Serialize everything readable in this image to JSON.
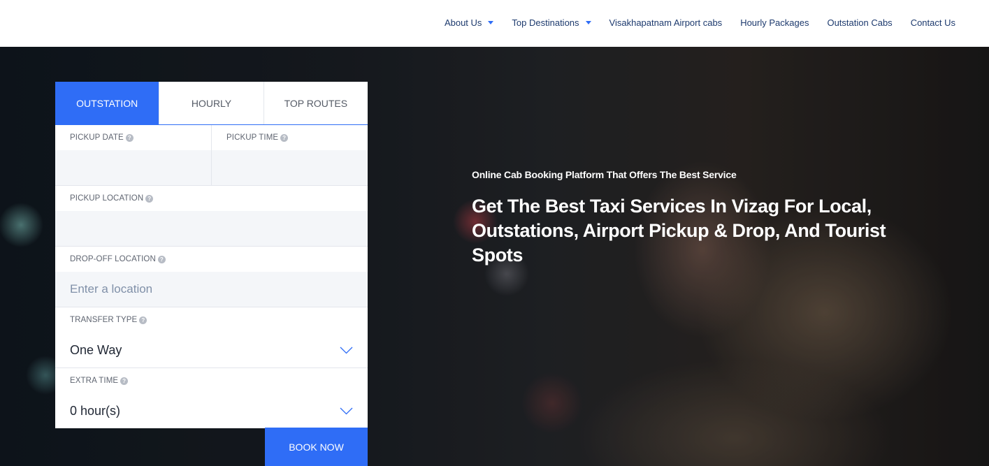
{
  "nav": {
    "items": [
      {
        "label": "About Us"
      },
      {
        "label": "Top Destinations"
      },
      {
        "label": "Visakhapatnam Airport cabs"
      },
      {
        "label": "Hourly Packages"
      },
      {
        "label": "Outstation Cabs"
      },
      {
        "label": "Contact Us"
      }
    ]
  },
  "hero": {
    "subtitle": "Online Cab Booking Platform That Offers The Best Service",
    "title": "Get The Best Taxi Services In Vizag For Local, Outstations, Airport Pickup & Drop, And Tourist Spots"
  },
  "booking": {
    "tabs": [
      {
        "label": "OUTSTATION",
        "active": true
      },
      {
        "label": "HOURLY"
      },
      {
        "label": "TOP ROUTES"
      }
    ],
    "pickup_date": {
      "label": "PICKUP DATE",
      "value": ""
    },
    "pickup_time": {
      "label": "PICKUP TIME",
      "value": ""
    },
    "pickup_location": {
      "label": "PICKUP LOCATION",
      "value": ""
    },
    "dropoff_location": {
      "label": "DROP-OFF LOCATION",
      "placeholder": "Enter a location",
      "value": ""
    },
    "transfer_type": {
      "label": "TRANSFER TYPE",
      "value": "One Way"
    },
    "extra_time": {
      "label": "EXTRA TIME",
      "value": "0 hour(s)"
    },
    "help_glyph": "?",
    "book_label": "BOOK NOW"
  },
  "colors": {
    "accent": "#2f6df6",
    "nav_text": "#1d3a6e",
    "field_bg": "#f4f6f9"
  },
  "icons": [
    "chevron-down-icon",
    "help-icon",
    "caret-down-icon"
  ]
}
